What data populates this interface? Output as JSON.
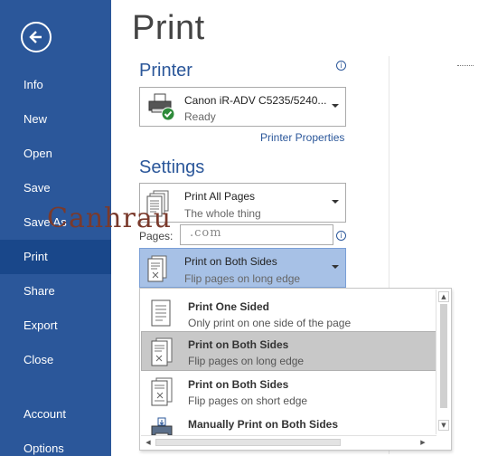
{
  "sidebar": {
    "items": [
      {
        "label": "Info"
      },
      {
        "label": "New"
      },
      {
        "label": "Open"
      },
      {
        "label": "Save"
      },
      {
        "label": "Save As"
      },
      {
        "label": "Print"
      },
      {
        "label": "Share"
      },
      {
        "label": "Export"
      },
      {
        "label": "Close"
      },
      {
        "label": "Account"
      },
      {
        "label": "Options"
      }
    ],
    "active": "Print",
    "colors": {
      "bg": "#2b579a",
      "active": "#19478a"
    }
  },
  "page": {
    "title": "Print"
  },
  "printer": {
    "heading": "Printer",
    "name": "Canon iR-ADV C5235/5240...",
    "status": "Ready",
    "properties_link": "Printer Properties",
    "icon": "printer-ready-icon"
  },
  "settings": {
    "heading": "Settings",
    "range": {
      "main": "Print All Pages",
      "sub": "The whole thing"
    },
    "pages_label": "Pages:",
    "pages_value": "",
    "sides": {
      "main": "Print on Both Sides",
      "sub": "Flip pages on long edge"
    }
  },
  "sides_options": [
    {
      "main": "Print One Sided",
      "sub": "Only print on one side of the page",
      "icon": "one-sided-icon"
    },
    {
      "main": "Print on Both Sides",
      "sub": "Flip pages on long edge",
      "icon": "duplex-long-edge-icon"
    },
    {
      "main": "Print on Both Sides",
      "sub": "Flip pages on short edge",
      "icon": "duplex-short-edge-icon"
    },
    {
      "main": "Manually Print on Both Sides",
      "sub": "",
      "icon": "manual-duplex-icon"
    }
  ],
  "highlighted_option": 1,
  "watermark": {
    "text": "Canhrau",
    "domain": ".com"
  },
  "accent": "#2b579a"
}
